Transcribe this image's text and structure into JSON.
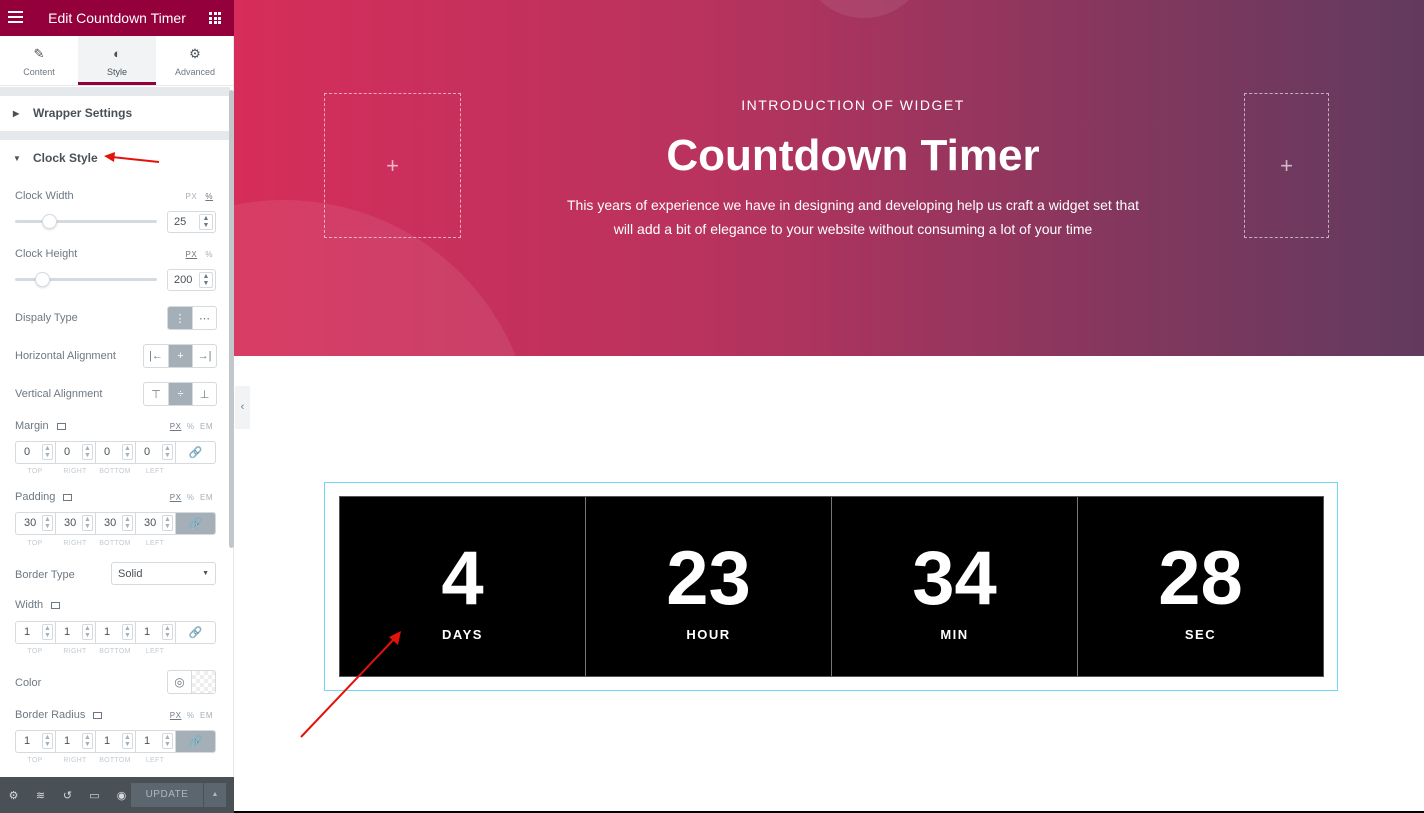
{
  "panel": {
    "title": "Edit Countdown Timer",
    "tabs": [
      {
        "label": "Content",
        "icon": "pencil-icon"
      },
      {
        "label": "Style",
        "icon": "contrast-icon",
        "active": true
      },
      {
        "label": "Advanced",
        "icon": "gear-icon"
      }
    ],
    "wrapper_section": "Wrapper Settings",
    "clock_section": "Clock Style",
    "clock_width": {
      "label": "Clock Width",
      "value": "25",
      "unit_px": "PX",
      "unit_pct": "%",
      "slider_fraction": 0.25
    },
    "clock_height": {
      "label": "Clock Height",
      "value": "200",
      "unit_px": "PX",
      "unit_pct": "%",
      "slider_fraction": 0.2
    },
    "display_type": {
      "label": "Dispaly Type"
    },
    "horizontal_alignment": {
      "label": "Horizontal Alignment"
    },
    "vertical_alignment": {
      "label": "Vertical Alignment"
    },
    "margin": {
      "label": "Margin",
      "values": [
        "0",
        "0",
        "0",
        "0"
      ]
    },
    "padding": {
      "label": "Padding",
      "values": [
        "30",
        "30",
        "30",
        "30"
      ]
    },
    "units": {
      "px": "PX",
      "pct": "%",
      "em": "EM"
    },
    "dim_labels": [
      "TOP",
      "RIGHT",
      "BOTTOM",
      "LEFT"
    ],
    "border_type": {
      "label": "Border Type",
      "value": "Solid"
    },
    "width": {
      "label": "Width",
      "values": [
        "1",
        "1",
        "1",
        "1"
      ]
    },
    "color": {
      "label": "Color"
    },
    "border_radius": {
      "label": "Border Radius",
      "values": [
        "1",
        "1",
        "1",
        "1"
      ]
    },
    "update_label": "UPDATE"
  },
  "hero": {
    "kicker": "INTRODUCTION OF WIDGET",
    "title": "Countdown Timer",
    "description_line1": "This years of experience we have in designing and developing help us craft a widget set that",
    "description_line2": "will add a bit of elegance to your website without consuming a lot of your time"
  },
  "timer": [
    {
      "value": "4",
      "label": "DAYS"
    },
    {
      "value": "23",
      "label": "HOUR"
    },
    {
      "value": "34",
      "label": "MIN"
    },
    {
      "value": "28",
      "label": "SEC"
    }
  ],
  "colors": {
    "brand": "#93003c",
    "arrow": "#e3120b"
  }
}
